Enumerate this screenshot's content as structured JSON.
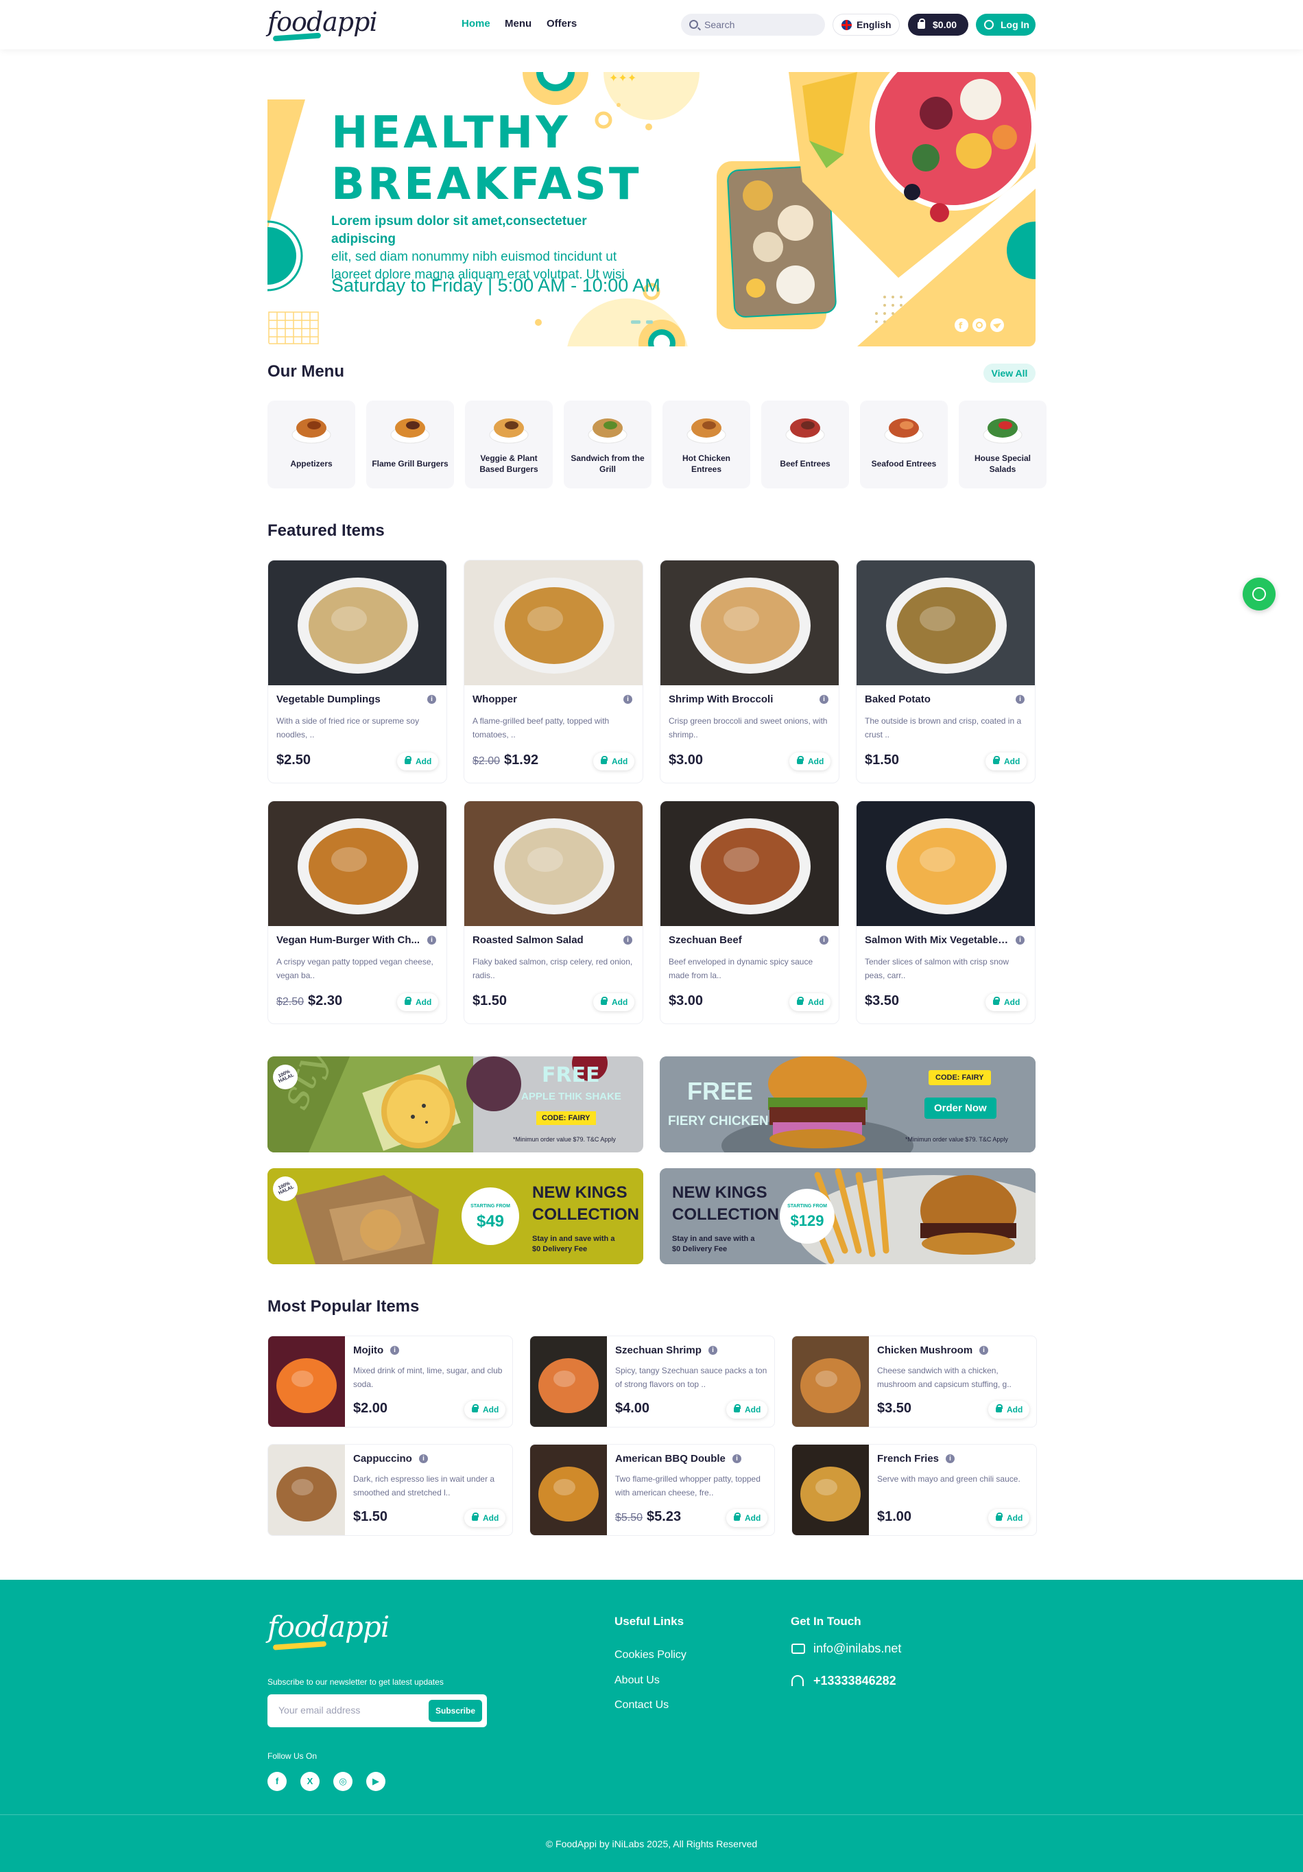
{
  "header": {
    "logo": "foodappi",
    "nav": [
      "Home",
      "Menu",
      "Offers"
    ],
    "search_placeholder": "Search",
    "language": "English",
    "cart_total": "$0.00",
    "login_label": "Log In"
  },
  "banner": {
    "title_line1": "HEALTHY",
    "title_line2": "BREAKFAST",
    "subtitle_bold": "Lorem ipsum dolor sit amet,consectetuer adipiscing",
    "subtitle_rest": "elit, sed diam nonummy nibh euismod tincidunt ut laoreet dolore magna aliquam erat volutpat. Ut wisi",
    "schedule": "Saturday to Friday | 5:00 AM - 10:00 AM"
  },
  "menu": {
    "title": "Our Menu",
    "view_all": "View All",
    "categories": [
      "Appetizers",
      "Flame Grill Burgers",
      "Veggie & Plant Based Burgers",
      "Sandwich from the Grill",
      "Hot Chicken Entrees",
      "Beef Entrees",
      "Seafood Entrees",
      "House Special Salads"
    ]
  },
  "featured": {
    "title": "Featured Items",
    "add_label": "Add",
    "items": [
      {
        "name": "Vegetable Dumplings",
        "desc": "With a side of fried rice or supreme soy noodles, ..",
        "old_price": "",
        "price": "$2.50"
      },
      {
        "name": "Whopper",
        "desc": "A flame-grilled beef patty, topped with tomatoes, ..",
        "old_price": "$2.00",
        "price": "$1.92"
      },
      {
        "name": "Shrimp With Broccoli",
        "desc": "Crisp green broccoli and sweet onions, with shrimp..",
        "old_price": "",
        "price": "$3.00"
      },
      {
        "name": "Baked Potato",
        "desc": "The outside is brown and crisp, coated in a crust ..",
        "old_price": "",
        "price": "$1.50"
      },
      {
        "name": "Vegan Hum-Burger With Ch...",
        "desc": "A crispy vegan patty topped vegan cheese, vegan ba..",
        "old_price": "$2.50",
        "price": "$2.30"
      },
      {
        "name": "Roasted Salmon Salad",
        "desc": "Flaky baked salmon, crisp celery, red onion, radis..",
        "old_price": "",
        "price": "$1.50"
      },
      {
        "name": "Szechuan Beef",
        "desc": "Beef enveloped in dynamic spicy sauce made from la..",
        "old_price": "",
        "price": "$3.00"
      },
      {
        "name": "Salmon With Mix Vegetables..",
        "desc": "Tender slices of salmon with crisp snow peas, carr..",
        "old_price": "",
        "price": "$3.50"
      }
    ]
  },
  "promos": {
    "p1": {
      "free": "FREE",
      "item": "APPLE THIK SHAKE",
      "code": "CODE: FAIRY",
      "note": "*Minimun order value $79. T&C Apply",
      "badge": "100% HALAL"
    },
    "p2": {
      "free": "FREE",
      "item": "FIERY CHICKEN",
      "code": "CODE: FAIRY",
      "cta": "Order Now",
      "note": "*Minimun order value $79. T&C Apply"
    },
    "p3": {
      "title1": "NEW KINGS",
      "title2": "COLLECTION",
      "starting": "STARTING FROM",
      "price": "$49",
      "line1": "Stay in and save with a",
      "line2": "$0 Delivery Fee",
      "badge": "100% HALAL"
    },
    "p4": {
      "title1": "NEW KINGS",
      "title2": "COLLECTION",
      "starting": "STARTING FROM",
      "price": "$129",
      "line1": "Stay in and save with a",
      "line2": "$0 Delivery Fee"
    }
  },
  "popular": {
    "title": "Most Popular Items",
    "add_label": "Add",
    "items": [
      {
        "name": "Mojito",
        "desc": "Mixed drink of mint, lime, sugar, and club soda.",
        "old_price": "",
        "price": "$2.00"
      },
      {
        "name": "Szechuan Shrimp",
        "desc": "Spicy, tangy Szechuan sauce packs a ton of strong flavors on top ..",
        "old_price": "",
        "price": "$4.00"
      },
      {
        "name": "Chicken Mushroom",
        "desc": "Cheese sandwich with a chicken, mushroom and capsicum stuffing, g..",
        "old_price": "",
        "price": "$3.50"
      },
      {
        "name": "Cappuccino",
        "desc": "Dark, rich espresso lies in wait under a smoothed and stretched l..",
        "old_price": "",
        "price": "$1.50"
      },
      {
        "name": "American BBQ Double",
        "desc": "Two flame-grilled whopper patty, topped with american cheese, fre..",
        "old_price": "$5.50",
        "price": "$5.23"
      },
      {
        "name": "French Fries",
        "desc": "Serve with mayo and green chili sauce.",
        "old_price": "",
        "price": "$1.00"
      }
    ]
  },
  "footer": {
    "logo": "foodappi",
    "newsletter_text": "Subscribe to our newsletter to get latest updates",
    "email_placeholder": "Your email address",
    "subscribe_label": "Subscribe",
    "follow_label": "Follow Us On",
    "social": [
      "f",
      "X",
      "◎",
      "▶"
    ],
    "useful_links_title": "Useful Links",
    "links": [
      "Cookies Policy",
      "About Us",
      "Contact Us"
    ],
    "contact_title": "Get In Touch",
    "email": "info@inilabs.net",
    "phone": "+13333846282",
    "copyright": "© FoodAppi by iNiLabs 2025, All Rights Reserved"
  },
  "colors": {
    "brand": "#00b09b",
    "dark": "#1f1f39",
    "accent_yellow": "#ffd233",
    "whatsapp": "#22c55e"
  }
}
